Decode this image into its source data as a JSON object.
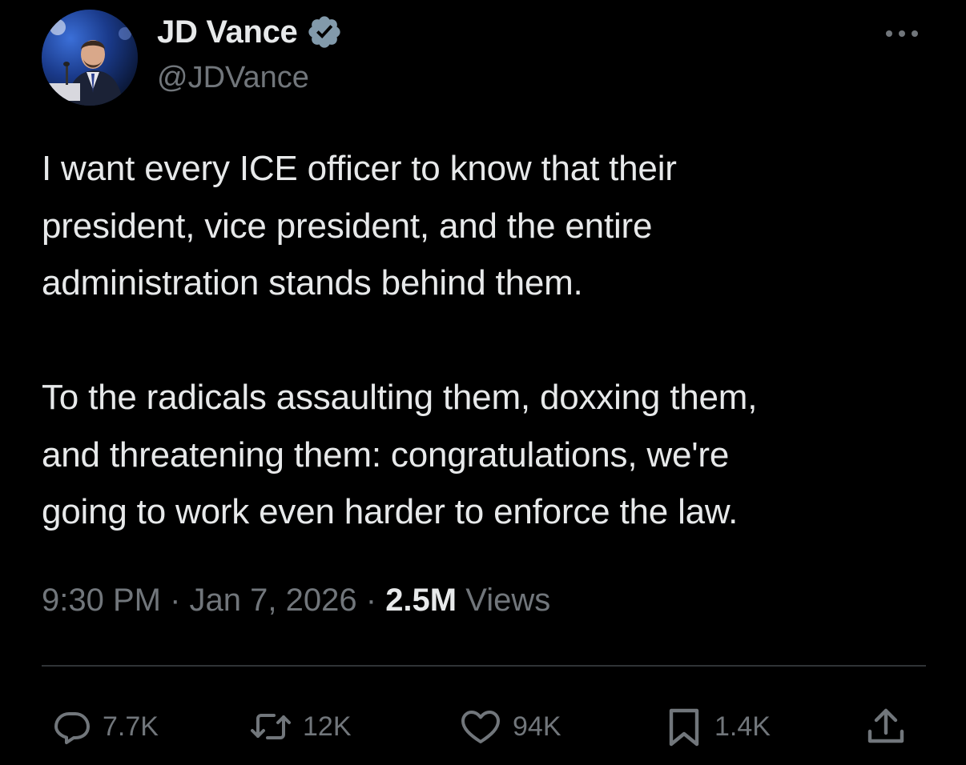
{
  "author": {
    "display_name": "JD Vance",
    "handle": "@JDVance",
    "verified": true,
    "verified_color": "#829aab"
  },
  "tweet": {
    "text": "I want every ICE officer to know that their\npresident, vice president, and the entire\nadministration stands behind them.\n\nTo the radicals assaulting them, doxxing them,\nand threatening them: congratulations, we're\ngoing to work even harder to enforce the law.",
    "time": "9:30 PM",
    "date": "Jan 7, 2026",
    "views_count": "2.5M",
    "views_label": "Views",
    "separator": "·"
  },
  "actions": {
    "replies": "7.7K",
    "reposts": "12K",
    "likes": "94K",
    "bookmarks": "1.4K"
  },
  "icons": {
    "more": "more-icon",
    "reply": "reply-icon",
    "repost": "repost-icon",
    "like": "heart-icon",
    "bookmark": "bookmark-icon",
    "share": "share-icon",
    "verified": "verified-badge-icon"
  },
  "colors": {
    "background": "#000000",
    "text_primary": "#e7e9ea",
    "text_secondary": "#71767b",
    "divider": "#2f3336"
  }
}
